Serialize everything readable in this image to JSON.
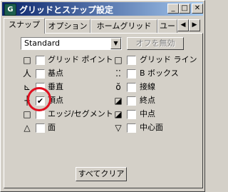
{
  "window": {
    "title": "グリッドとスナップ設定",
    "app_icon_glyph": "G"
  },
  "title_buttons": {
    "minimize": "_",
    "maximize": "□",
    "close": "✕"
  },
  "tabs": [
    {
      "label": "スナップ",
      "active": true
    },
    {
      "label": "オプション"
    },
    {
      "label": "ホームグリッド"
    },
    {
      "label": "ユー"
    }
  ],
  "tab_scroll": {
    "left": "◀",
    "right": "▶"
  },
  "snap_type_select": {
    "value": "Standard",
    "arrow": "▼"
  },
  "off_override_button": {
    "label": "オフを無効",
    "enabled": false
  },
  "left_column": [
    {
      "icon": "grid-points-icon",
      "glyph": "□",
      "label": "グリッド ポイント",
      "checked": false
    },
    {
      "icon": "pivot-icon",
      "glyph": "人",
      "label": "基点",
      "checked": false
    },
    {
      "icon": "perpendicular-icon",
      "glyph": "⊾",
      "label": "垂直",
      "checked": false
    },
    {
      "icon": "vertex-icon",
      "glyph": "┼",
      "label": "頂点",
      "checked": true
    },
    {
      "icon": "edge-segment-icon",
      "glyph": "□",
      "label": "エッジ/セグメント",
      "checked": false
    },
    {
      "icon": "face-icon",
      "glyph": "△",
      "label": "面",
      "checked": false
    }
  ],
  "right_column": [
    {
      "icon": "grid-lines-icon",
      "glyph": "□",
      "label": "グリッド ライン",
      "checked": false
    },
    {
      "icon": "bounding-box-icon",
      "glyph": "⁚⁚",
      "label": "B ボックス",
      "checked": false
    },
    {
      "icon": "tangent-icon",
      "glyph": "ŏ",
      "label": "接線",
      "checked": false
    },
    {
      "icon": "endpoint-icon",
      "glyph": "◪",
      "label": "終点",
      "checked": false
    },
    {
      "icon": "midpoint-icon",
      "glyph": "◪",
      "label": "中点",
      "checked": false
    },
    {
      "icon": "center-face-icon",
      "glyph": "▽",
      "label": "中心面",
      "checked": false
    }
  ],
  "checkmark": "✔",
  "clear_all_button": {
    "label": "すべてクリア"
  },
  "colors": {
    "titlebar_start": "#0a246a",
    "titlebar_end": "#a6caf0",
    "highlight_circle": "#e01020"
  }
}
